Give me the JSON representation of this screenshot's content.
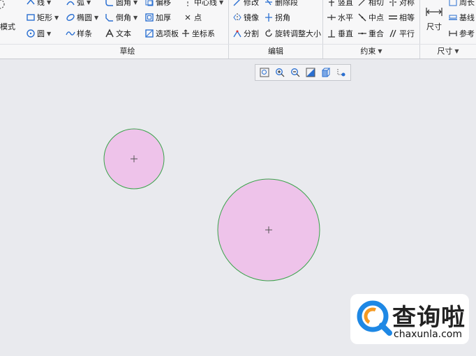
{
  "ribbon": {
    "mode_label": "模式",
    "groups": {
      "sketch": "草绘",
      "edit": "编辑",
      "constrain": "约束",
      "dimension": "尺寸"
    },
    "sketch": {
      "line": "线",
      "arc": "弧",
      "fillet": "圆角",
      "offset": "偏移",
      "centerline": "中心线",
      "rectangle": "矩形",
      "ellipse": "椭圆",
      "chamfer": "倒角",
      "thicken": "加厚",
      "point": "点",
      "circle": "圆",
      "spline": "样条",
      "text": "文本",
      "palette": "选项板",
      "coord_system": "坐标系"
    },
    "edit": {
      "modify": "修改",
      "delete_segment": "删除段",
      "mirror": "镜像",
      "corner": "拐角",
      "divide": "分割",
      "rotate_resize": "旋转调整大小"
    },
    "constrain": {
      "vertical": "竖直",
      "tangent": "相切",
      "symmetric": "对称",
      "horizontal": "水平",
      "midpoint": "中点",
      "equal": "相等",
      "perpendicular": "垂直",
      "coincident": "重合",
      "parallel": "平行"
    },
    "dimension": {
      "dimension": "尺寸",
      "perimeter": "周长",
      "baseline": "基线",
      "reference": "参考"
    }
  },
  "colors": {
    "circle_fill": "#eec3ea",
    "circle_stroke": "#3aa34a",
    "canvas_bg": "#e9eaee",
    "watermark_blue": "#1e88e5",
    "watermark_orange": "#f59a23"
  },
  "watermark": {
    "name_cn": "查询啦",
    "name_en": "chaxunla.com"
  }
}
